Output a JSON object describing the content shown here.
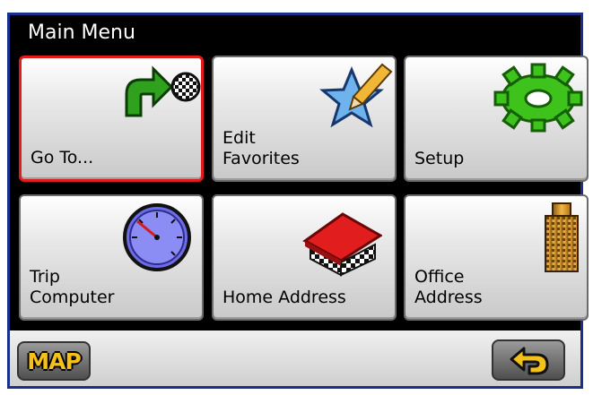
{
  "header": {
    "title": "Main Menu"
  },
  "menu": {
    "items": [
      {
        "label": "Go To...",
        "icon": "arrow-checkered-flag-icon",
        "selected": true
      },
      {
        "label": "Edit\nFavorites",
        "icon": "star-pencil-icon",
        "selected": false
      },
      {
        "label": "Setup",
        "icon": "gear-icon",
        "selected": false
      },
      {
        "label": "Trip\nComputer",
        "icon": "speedometer-icon",
        "selected": false
      },
      {
        "label": "Home Address",
        "icon": "house-icon",
        "selected": false
      },
      {
        "label": "Office\nAddress",
        "icon": "office-building-icon",
        "selected": false
      }
    ]
  },
  "footer": {
    "map_label": "MAP",
    "back_icon": "back-arrow-icon"
  },
  "colors": {
    "selected_border": "#e41b1b",
    "map_text": "#f3c11a",
    "frame": "#1a2f8a"
  }
}
